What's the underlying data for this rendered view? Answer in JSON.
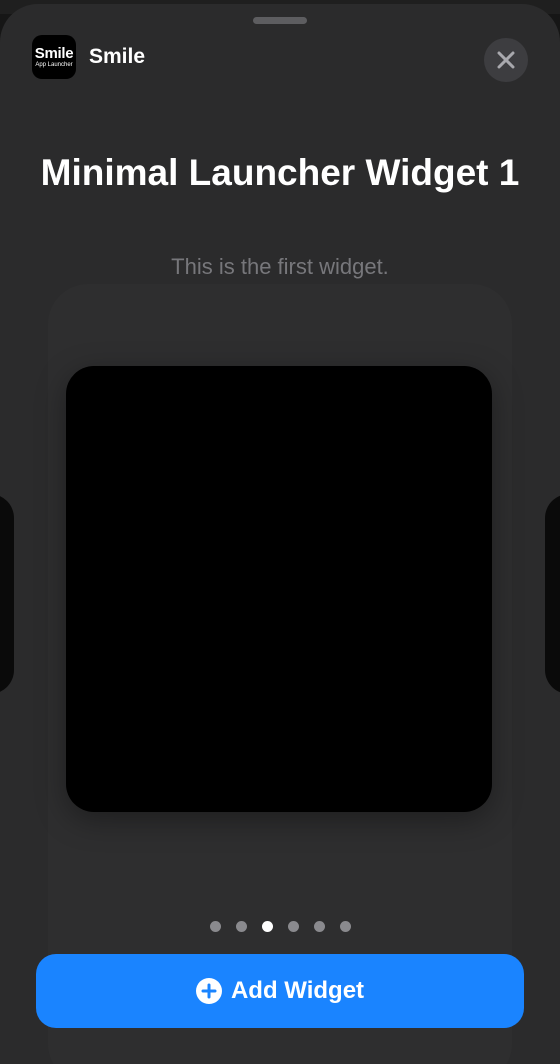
{
  "app": {
    "icon_main": "Smile",
    "icon_sub": "App Launcher",
    "name": "Smile"
  },
  "widget": {
    "title": "Minimal Launcher Widget 1",
    "subtitle": "This is the first widget."
  },
  "pagination": {
    "total": 6,
    "current": 3
  },
  "actions": {
    "add_label": "Add Widget",
    "close_icon": "close-icon",
    "add_icon": "plus-circle-icon"
  },
  "colors": {
    "accent": "#1a84ff",
    "sheet": "#2b2b2c"
  }
}
